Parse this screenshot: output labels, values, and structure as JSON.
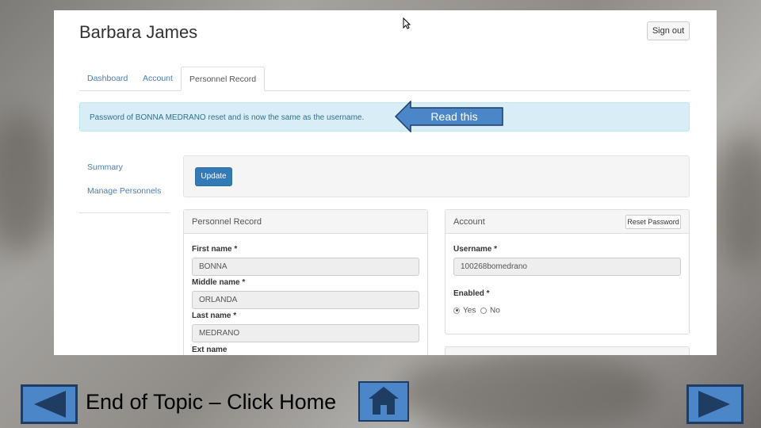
{
  "app": {
    "user_name": "Barbara James",
    "signout_label": "Sign out"
  },
  "tabs": [
    {
      "label": "Dashboard",
      "active": false
    },
    {
      "label": "Account",
      "active": false
    },
    {
      "label": "Personnel Record",
      "active": true
    }
  ],
  "alert": {
    "message": "Password of BONNA MEDRANO reset and is now the same as the username."
  },
  "callout": {
    "text": "Read this"
  },
  "sidebar": {
    "items": [
      {
        "label": "Summary"
      },
      {
        "label": "Manage Personnels"
      }
    ]
  },
  "toolbar": {
    "update_label": "Update"
  },
  "personnel_panel": {
    "title": "Personnel Record",
    "fields": [
      {
        "label": "First name *",
        "value": "BONNA"
      },
      {
        "label": "Middle name *",
        "value": "ORLANDA"
      },
      {
        "label": "Last name *",
        "value": "MEDRANO"
      },
      {
        "label": "Ext name",
        "value": ""
      }
    ]
  },
  "account_panel": {
    "title": "Account",
    "reset_label": "Reset Password",
    "username_label": "Username *",
    "username_value": "100268bomedrano",
    "enabled_label": "Enabled *",
    "enabled_options": [
      {
        "label": "Yes",
        "selected": true
      },
      {
        "label": "No",
        "selected": false
      }
    ]
  },
  "slide": {
    "caption": "End of Topic – Click Home"
  },
  "icons": {
    "back": "triangle-left-icon",
    "home": "house-icon",
    "forward": "triangle-right-icon"
  },
  "colors": {
    "nav_button": "#4a86c8",
    "nav_border": "#1f3c63",
    "alert_bg": "#d9edf7",
    "primary": "#337ab7"
  }
}
